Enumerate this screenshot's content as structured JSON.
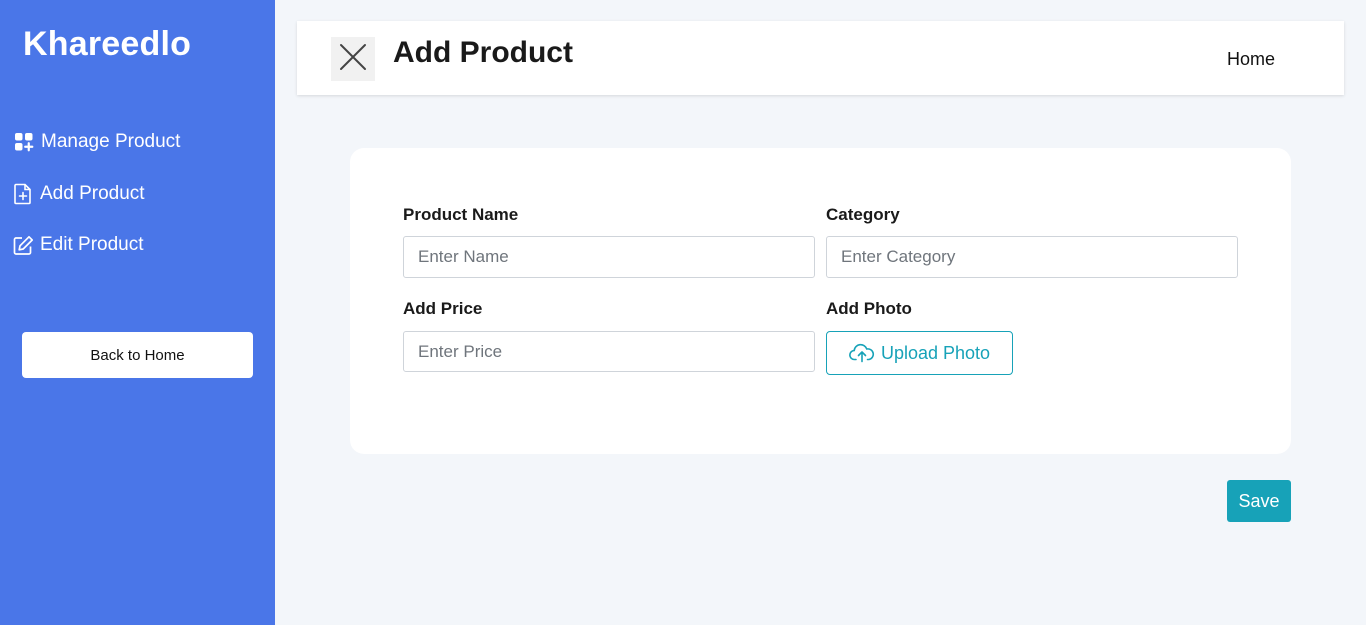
{
  "sidebar": {
    "brand": "Khareedlo",
    "items": [
      {
        "label": "Manage Product",
        "icon": "grid-plus-icon"
      },
      {
        "label": "Add Product",
        "icon": "file-plus-icon"
      },
      {
        "label": "Edit Product",
        "icon": "edit-icon"
      }
    ],
    "back_button": "Back to Home"
  },
  "header": {
    "title": "Add Product",
    "home_link": "Home",
    "close_icon": "close-icon"
  },
  "form": {
    "product_name": {
      "label": "Product Name",
      "placeholder": "Enter Name"
    },
    "category": {
      "label": "Category",
      "placeholder": "Enter Category"
    },
    "price": {
      "label": "Add Price",
      "placeholder": "Enter Price"
    },
    "photo": {
      "label": "Add Photo",
      "button": "Upload Photo",
      "icon": "cloud-upload-icon"
    }
  },
  "actions": {
    "save": "Save"
  },
  "colors": {
    "sidebar": "#4a76e8",
    "accent": "#17a2b8",
    "background": "#f3f6fa"
  }
}
